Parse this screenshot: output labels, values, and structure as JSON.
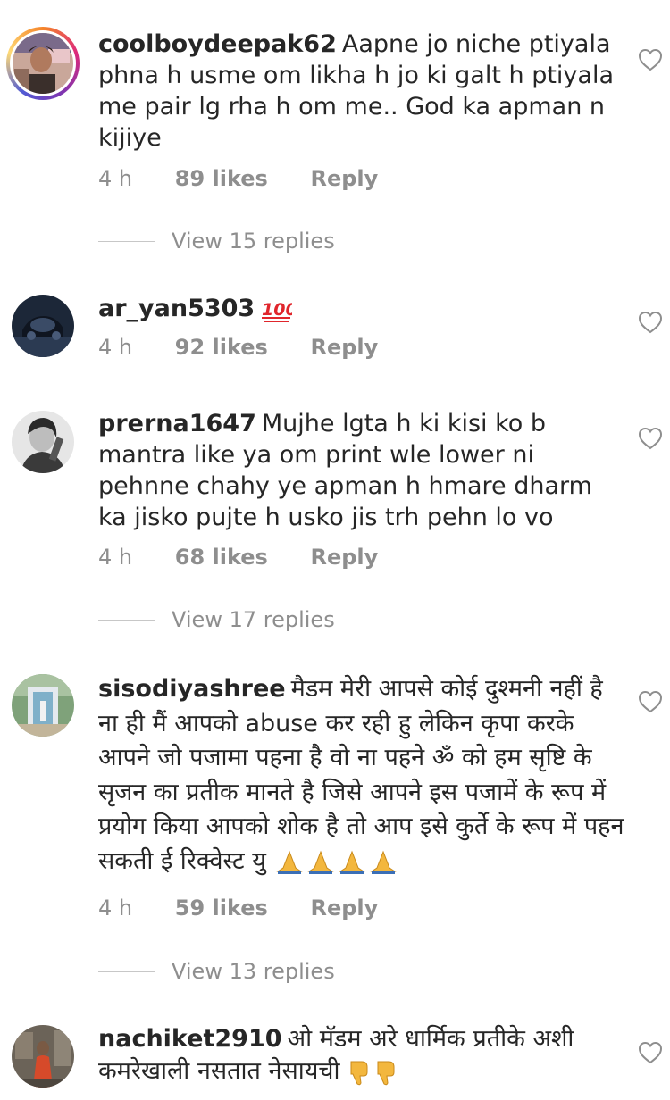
{
  "comments": [
    {
      "username": "coolboydeepak62",
      "text": "Aapne jo niche ptiyala phna h usme om likha h jo ki galt h ptiyala me pair lg rha h om me.. God ka apman n kijiye",
      "time": "4 h",
      "likes": "89 likes",
      "reply": "Reply",
      "view_replies": "View 15 replies",
      "avatar_icon": "profile-photo-man-with-ring"
    },
    {
      "username": "ar_yan5303",
      "text": "",
      "emoji_icon": "hundred-points-emoji",
      "time": "4 h",
      "likes": "92 likes",
      "reply": "Reply",
      "avatar_icon": "profile-photo-car-dark"
    },
    {
      "username": "prerna1647",
      "text": "Mujhe lgta h ki kisi ko b mantra like ya om print wle lower ni pehnne chahy ye apman h hmare dharm ka jisko pujte h usko jis trh pehn lo vo",
      "time": "4 h",
      "likes": "68 likes",
      "reply": "Reply",
      "view_replies": "View 17 replies",
      "avatar_icon": "profile-photo-woman-bw"
    },
    {
      "username": "sisodiyashree",
      "text": "मैडम मेरी आपसे कोई दुश्मनी नहीं है ना ही मैं आपको abuse कर रही हु लेकिन कृपा करके आपने जो पजामा पहना है वो ना पहने ॐ को हम सृष्टि के सृजन का प्रतीक मानते है जिसे आपने इस पजामें के रूप में प्रयोग किया आपको शोक है तो आप इसे कुर्ते के रूप में पहन सकती ई रिक्वेस्ट यु",
      "emoji_icon": "folded-hands-emoji",
      "emoji_count": 4,
      "time": "4 h",
      "likes": "59 likes",
      "reply": "Reply",
      "view_replies": "View 13 replies",
      "avatar_icon": "profile-photo-garden-gate"
    },
    {
      "username": "nachiket2910",
      "text": "ओ मॅडम अरे धार्मिक प्रतीके अशी कमरेखाली नसतात नेसायची",
      "emoji_icon": "thumbs-down-emoji",
      "emoji_count": 2,
      "avatar_icon": "profile-photo-person-red"
    }
  ],
  "colors": {
    "text": "#262626",
    "secondary": "#8e8e8e",
    "divider": "#c7c7c7"
  },
  "icons": {
    "like": "heart-outline-icon"
  }
}
